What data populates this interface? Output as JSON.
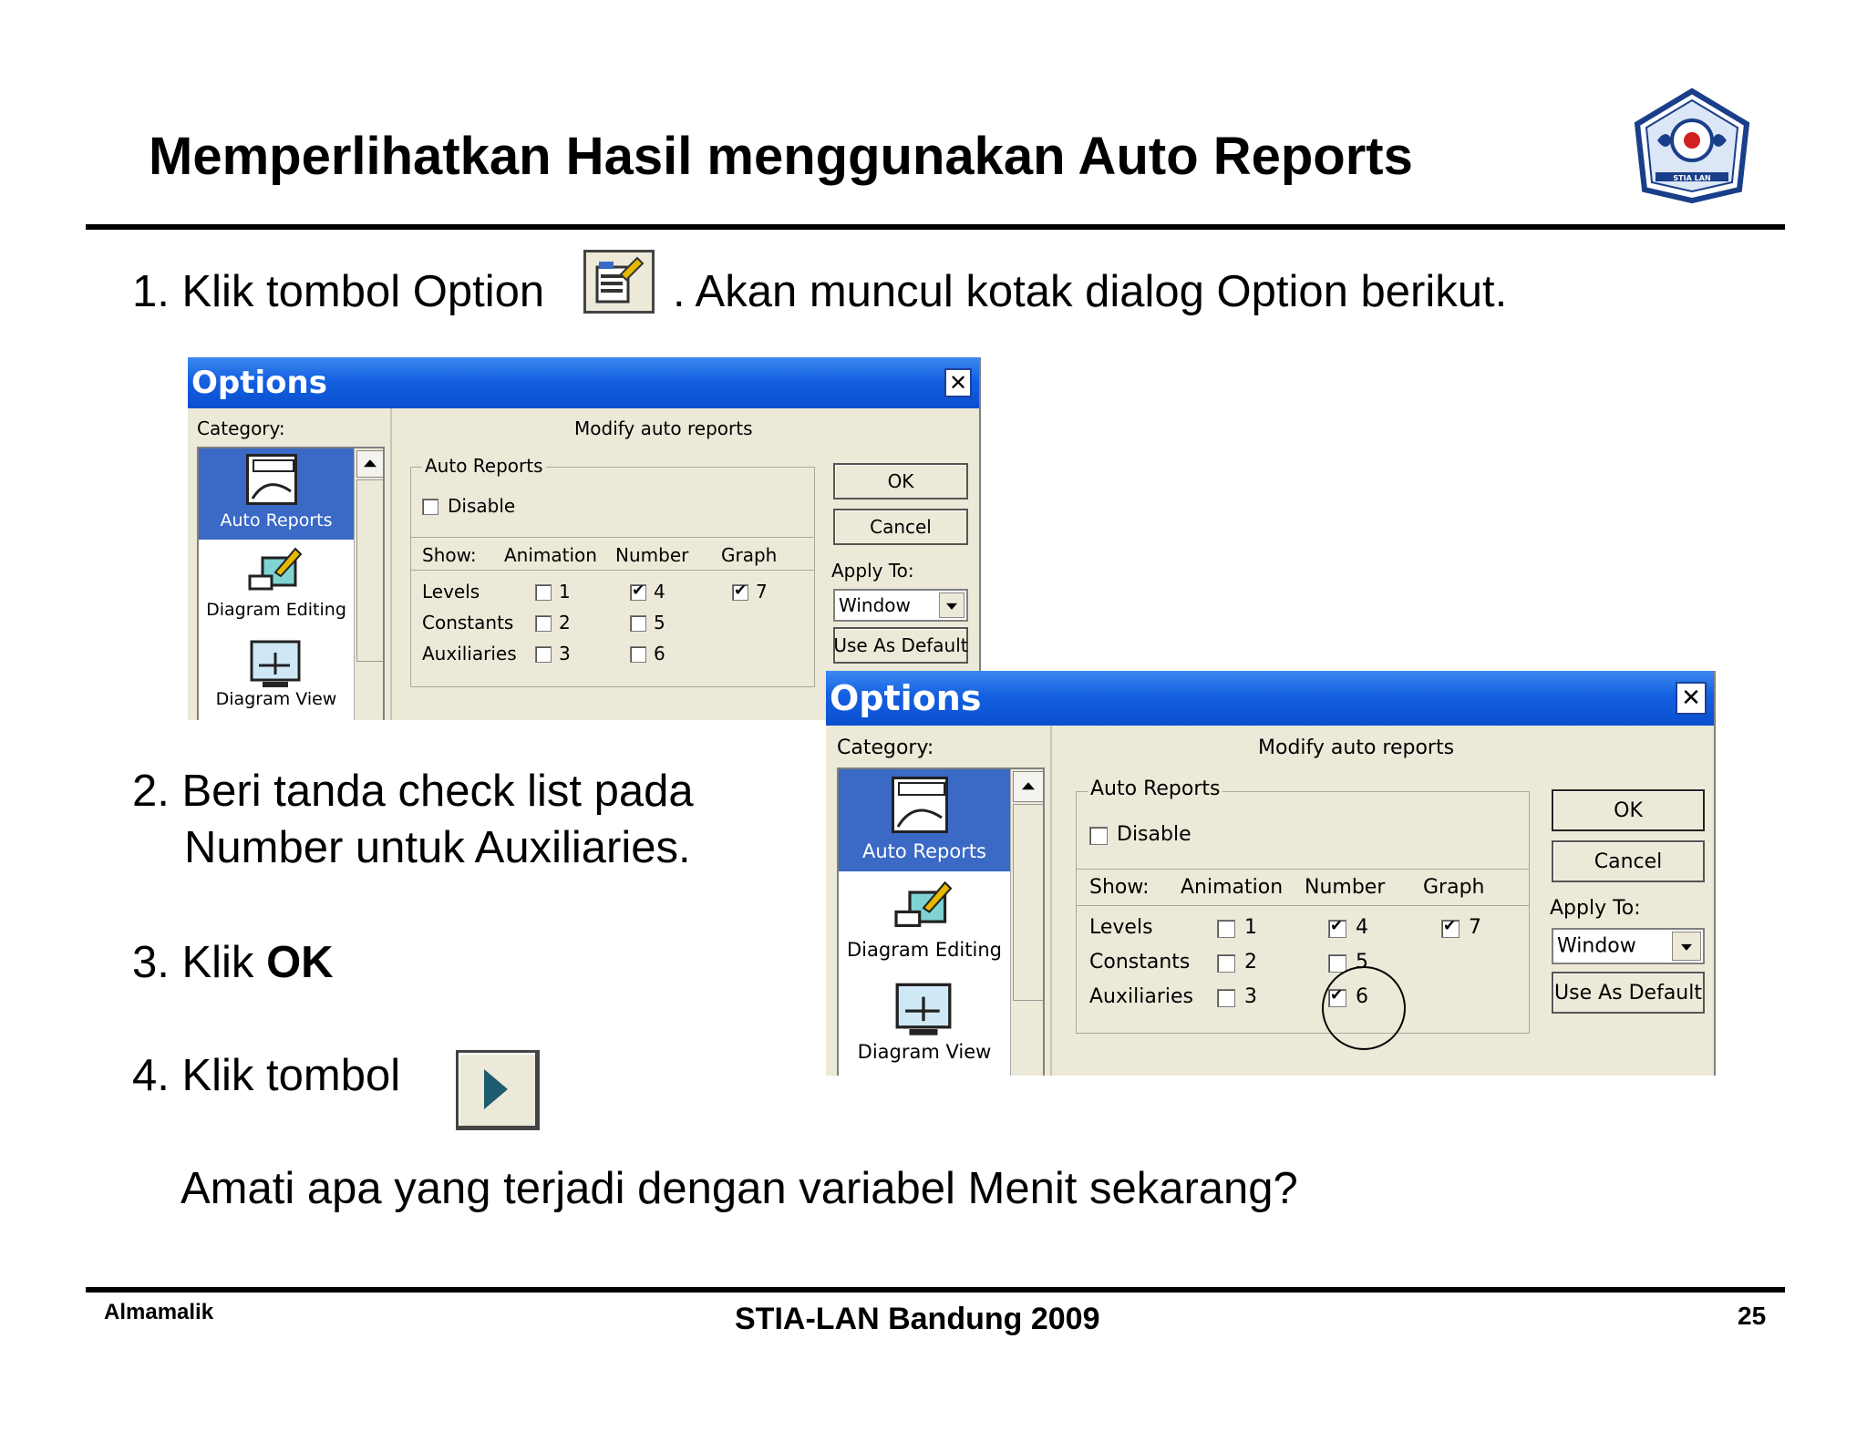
{
  "title": "Memperlihatkan Hasil menggunakan Auto Reports",
  "steps": {
    "s1_part1": "1. Klik tombol Option",
    "s1_part2": ". Akan muncul kotak dialog Option berikut.",
    "s2_line1": "2. Beri tanda check list pada",
    "s2_line2": "Number untuk Auxiliaries.",
    "s3_prefix": "3. Klik ",
    "s3_bold": "OK",
    "s4": "4. Klik tombol",
    "question": "Amati apa yang terjadi dengan variabel Menit sekarang?"
  },
  "logo_text": "STIA LAN",
  "dialog1": {
    "title": "Options",
    "category_label": "Category:",
    "heading": "Modify auto reports",
    "group_label": "Auto Reports",
    "disable_label": "Disable",
    "headers": {
      "show": "Show:",
      "animation": "Animation",
      "number": "Number",
      "graph": "Graph"
    },
    "rows": [
      {
        "label": "Levels",
        "a": "1",
        "n": "4",
        "g": "7"
      },
      {
        "label": "Constants",
        "a": "2",
        "n": "5"
      },
      {
        "label": "Auxiliaries",
        "a": "3",
        "n": "6"
      }
    ],
    "categories": [
      "Auto Reports",
      "Diagram Editing",
      "Diagram View"
    ],
    "ok": "OK",
    "cancel": "Cancel",
    "apply_to": "Apply To:",
    "apply_value": "Window",
    "use_default": "Use As Default",
    "checked": {
      "disable": false,
      "a1": false,
      "a2": false,
      "a3": false,
      "n4": true,
      "n5": false,
      "n6": false,
      "g7": true
    }
  },
  "dialog2": {
    "title": "Options",
    "category_label": "Category:",
    "heading": "Modify auto reports",
    "group_label": "Auto Reports",
    "disable_label": "Disable",
    "headers": {
      "show": "Show:",
      "animation": "Animation",
      "number": "Number",
      "graph": "Graph"
    },
    "rows": [
      {
        "label": "Levels",
        "a": "1",
        "n": "4",
        "g": "7"
      },
      {
        "label": "Constants",
        "a": "2",
        "n": "5"
      },
      {
        "label": "Auxiliaries",
        "a": "3",
        "n": "6"
      }
    ],
    "categories": [
      "Auto Reports",
      "Diagram Editing",
      "Diagram View"
    ],
    "ok": "OK",
    "cancel": "Cancel",
    "apply_to": "Apply To:",
    "apply_value": "Window",
    "use_default": "Use As Default",
    "checked": {
      "disable": false,
      "a1": false,
      "a2": false,
      "a3": false,
      "n4": true,
      "n5": false,
      "n6": true,
      "g7": true
    }
  },
  "footer": {
    "author": "Almamalik",
    "center": "STIA-LAN Bandung 2009",
    "page": "25"
  },
  "icons": [
    "options-icon",
    "play-button-icon",
    "auto-reports-icon",
    "diagram-editing-icon",
    "diagram-view-icon",
    "stia-lan-logo"
  ]
}
